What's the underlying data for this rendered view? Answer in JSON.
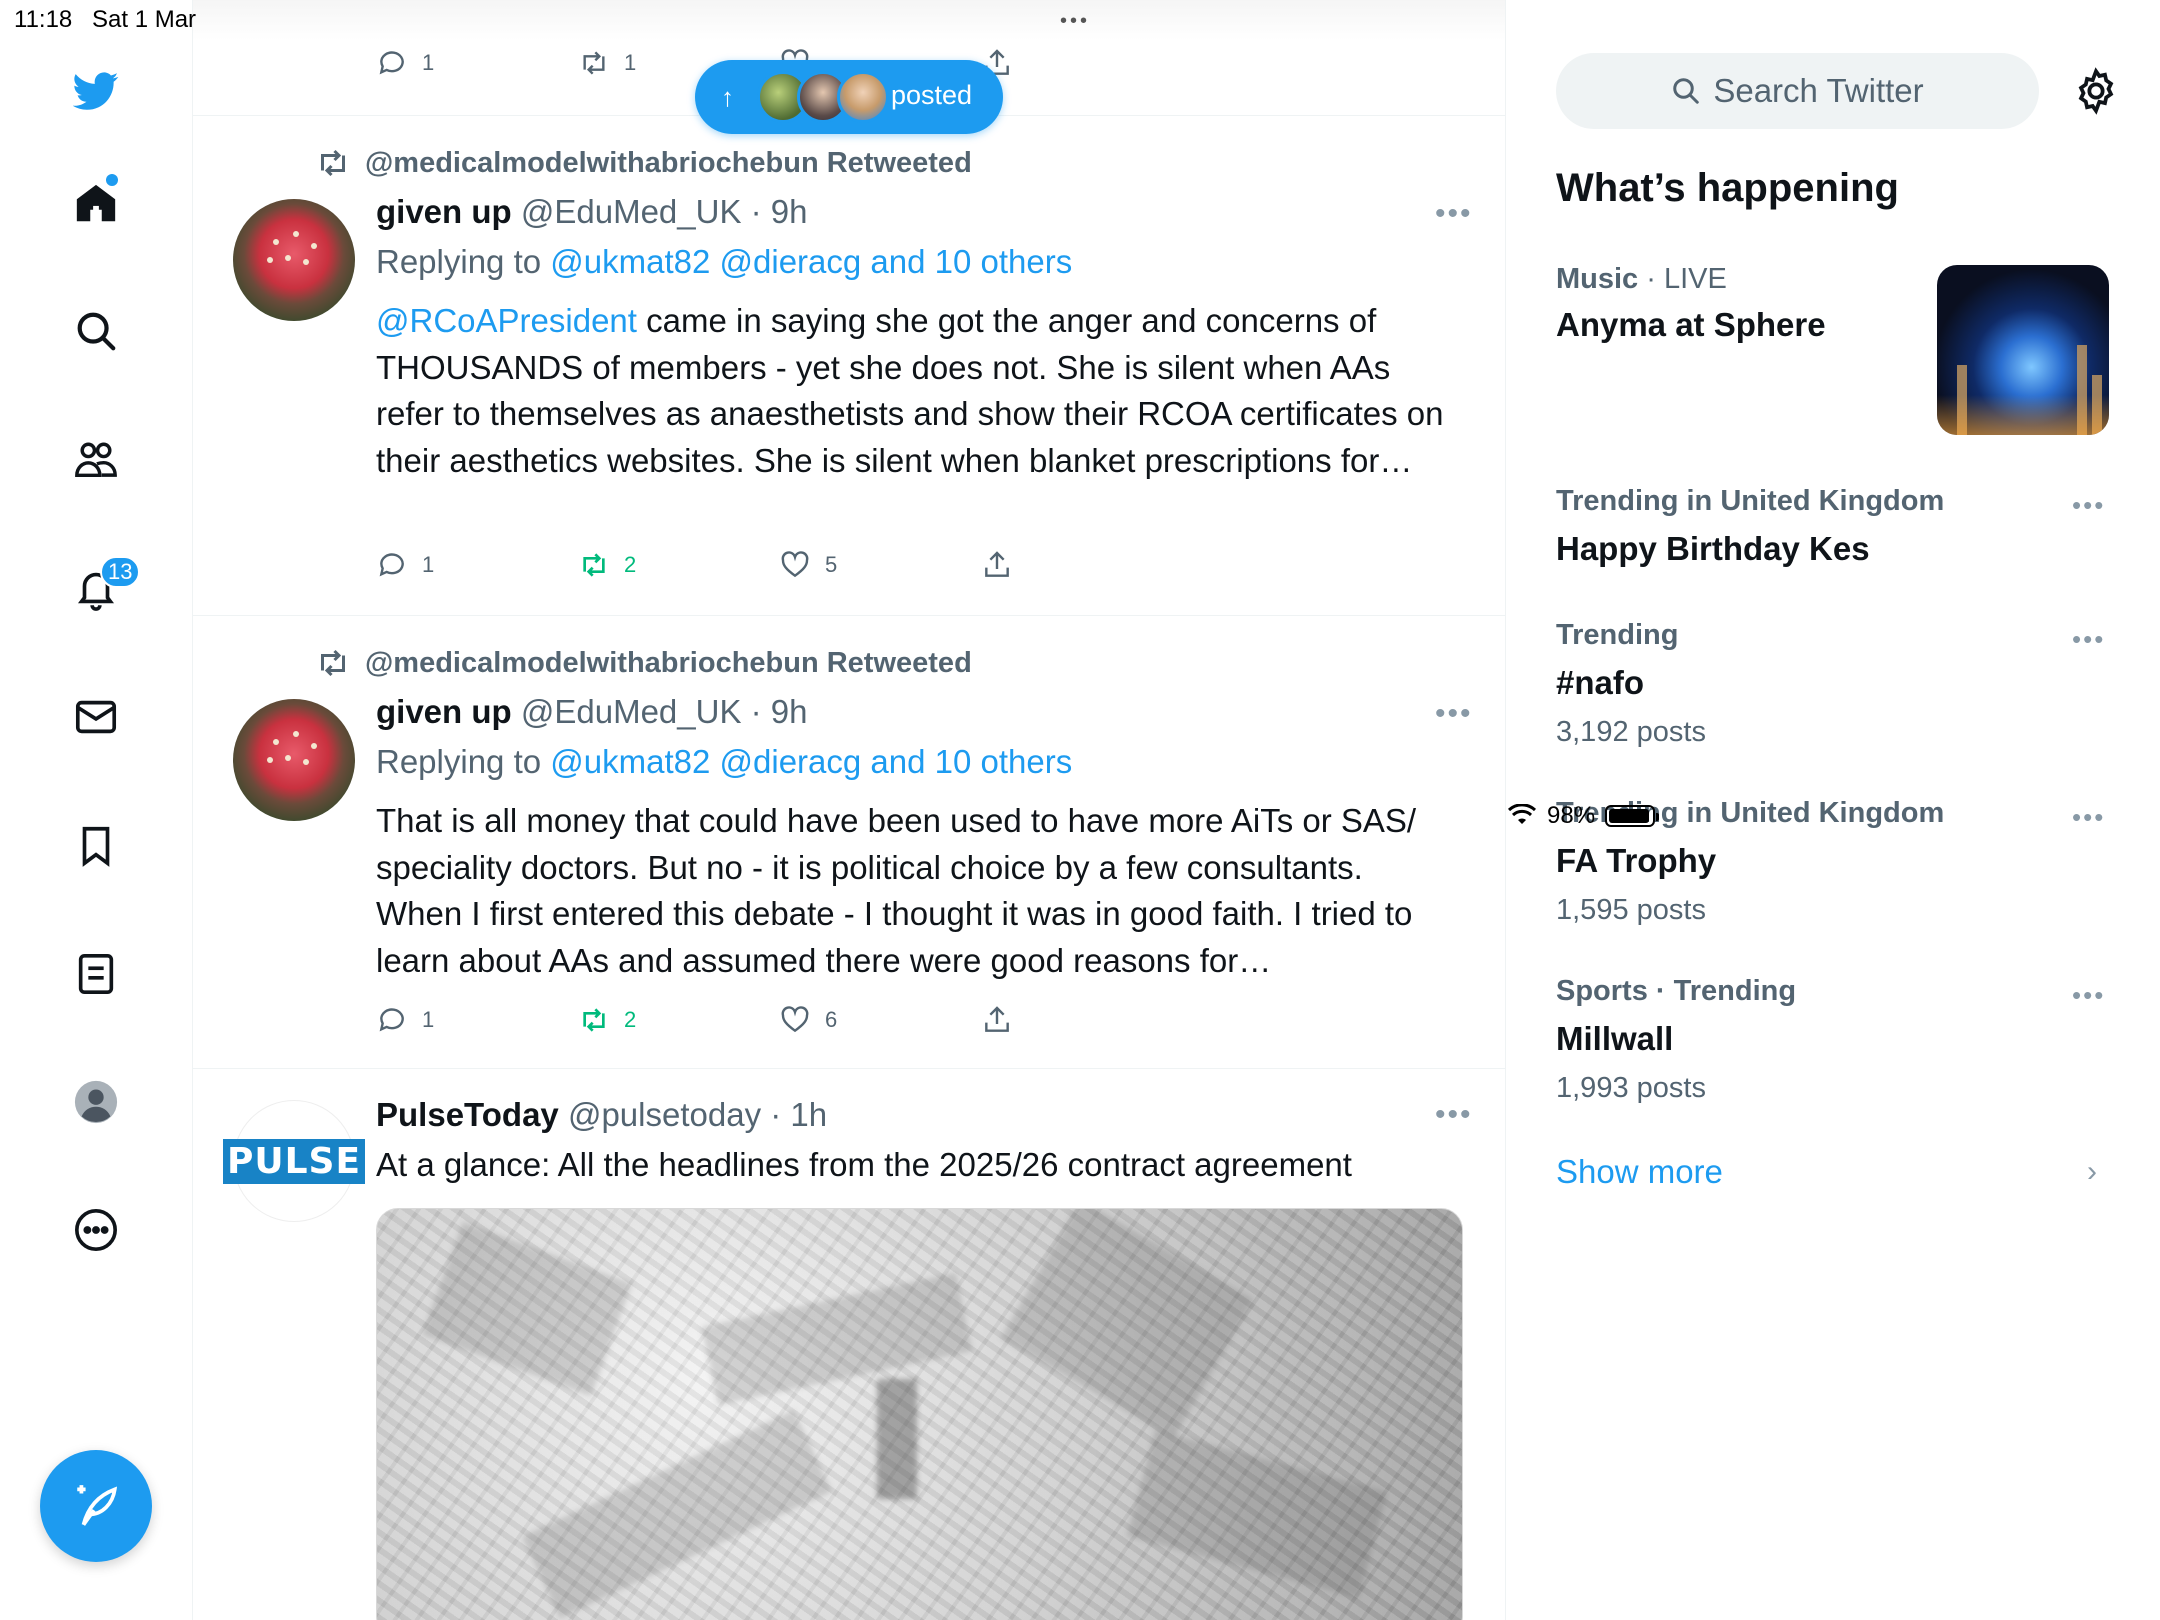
{
  "status": {
    "time": "11:18",
    "date": "Sat 1 Mar",
    "battery": "98%"
  },
  "nav": {
    "notifications_count": "13"
  },
  "pill": {
    "label": "posted"
  },
  "top_tweet": {
    "replies": "1",
    "retweets": "1"
  },
  "tweets": [
    {
      "retweeted_by": "@medicalmodelwithabriochebun Retweeted",
      "name": "given up",
      "handle": "@EduMed_UK",
      "time": "· 9h",
      "replying_prefix": "Replying to",
      "replying_to": "@ukmat82 @dieracg and 10 others",
      "mention": "@RCoAPresident",
      "text": " came in saying she got the anger and concerns of THOUSANDS of members - yet she does not. She is silent when AAs refer to themselves as anaesthetists and show their RCOA certificates on their aesthetics websites. She is silent when blanket prescriptions for…",
      "replies": "1",
      "retweets": "2",
      "likes": "5"
    },
    {
      "retweeted_by": "@medicalmodelwithabriochebun Retweeted",
      "name": "given up",
      "handle": "@EduMed_UK",
      "time": "· 9h",
      "replying_prefix": "Replying to",
      "replying_to": "@ukmat82 @dieracg and 10 others",
      "text": "That is all money that could have been used to have more AiTs or SAS/ speciality doctors. But no - it is political choice by a few consultants. When I first entered this debate - I thought it was in good faith. I tried to learn about AAs and assumed there were good reasons for…",
      "replies": "1",
      "retweets": "2",
      "likes": "6"
    },
    {
      "name": "PulseToday",
      "handle": "@pulsetoday",
      "time": "· 1h",
      "avatar_text": "PULSE",
      "text": "At a glance: All the headlines from the 2025/26 contract agreement"
    }
  ],
  "sidebar": {
    "search_placeholder": "Search Twitter",
    "heading": "What’s happening",
    "trends": [
      {
        "category": "Music",
        "suffix": " · LIVE",
        "title": "Anyma at Sphere",
        "count": ""
      },
      {
        "category": "Trending in United Kingdom",
        "suffix": "",
        "title": "Happy Birthday Kes",
        "count": ""
      },
      {
        "category": "Trending",
        "suffix": "",
        "title": "#nafo",
        "count": "3,192 posts"
      },
      {
        "category": "Trending in United Kingdom",
        "suffix": "",
        "title": "FA Trophy",
        "count": "1,595 posts"
      },
      {
        "category": "Sports · Trending",
        "suffix": "",
        "title": "Millwall",
        "count": "1,993 posts"
      }
    ],
    "show_more": "Show more"
  },
  "colors": {
    "accent": "#1d9bf0",
    "retweet": "#00ba7c",
    "muted": "#536471"
  }
}
